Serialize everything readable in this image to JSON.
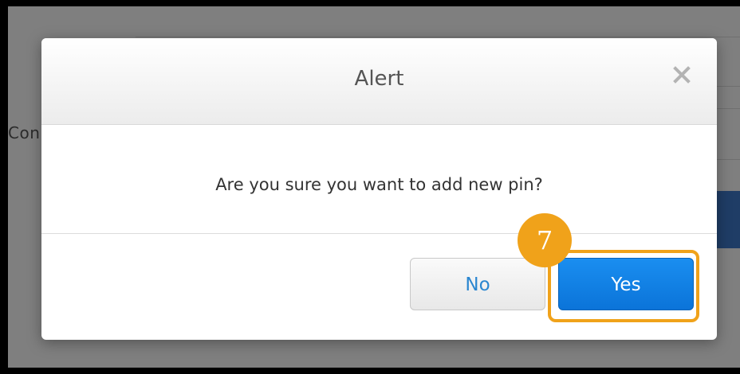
{
  "background": {
    "partial_label": "Con"
  },
  "dialog": {
    "title": "Alert",
    "close_icon": "close-icon",
    "message": "Are you sure you want to add new pin?",
    "no_label": "No",
    "yes_label": "Yes"
  },
  "annotation": {
    "step_number": "7",
    "highlight_color": "#f0a21a"
  },
  "colors": {
    "primary_button": "#0b74d9",
    "link_text": "#2a86d0",
    "overlay": "#7f7f7f"
  }
}
